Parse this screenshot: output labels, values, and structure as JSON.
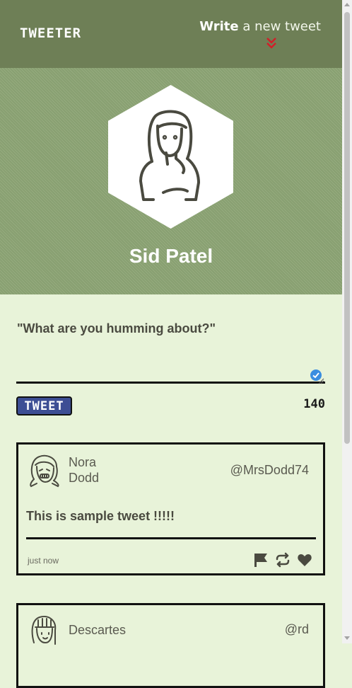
{
  "nav": {
    "brand": "TWEETER",
    "compose_bold": "Write",
    "compose_rest": " a new tweet",
    "chevron_icon": "double-chevron-down-icon",
    "accent": "#d0202a"
  },
  "profile": {
    "name": "Sid Patel",
    "avatar_icon": "user-avatar-icon"
  },
  "compose": {
    "placeholder": "\"What are you humming about?\"",
    "button_label": "TWEET",
    "counter": "140"
  },
  "tweets": [
    {
      "author": "Nora Dodd",
      "handle": "@MrsDodd74",
      "text": "This is sample tweet !!!!!",
      "time": "just now",
      "avatar_icon": "avatar-icon"
    },
    {
      "author": "Descartes",
      "handle": "@rd",
      "avatar_icon": "avatar-icon"
    }
  ],
  "colors": {
    "nav_bg": "#6e7f56",
    "header_bg": "#8ea676",
    "page_bg": "#e8f3d9",
    "button_bg": "#3d4e94"
  }
}
